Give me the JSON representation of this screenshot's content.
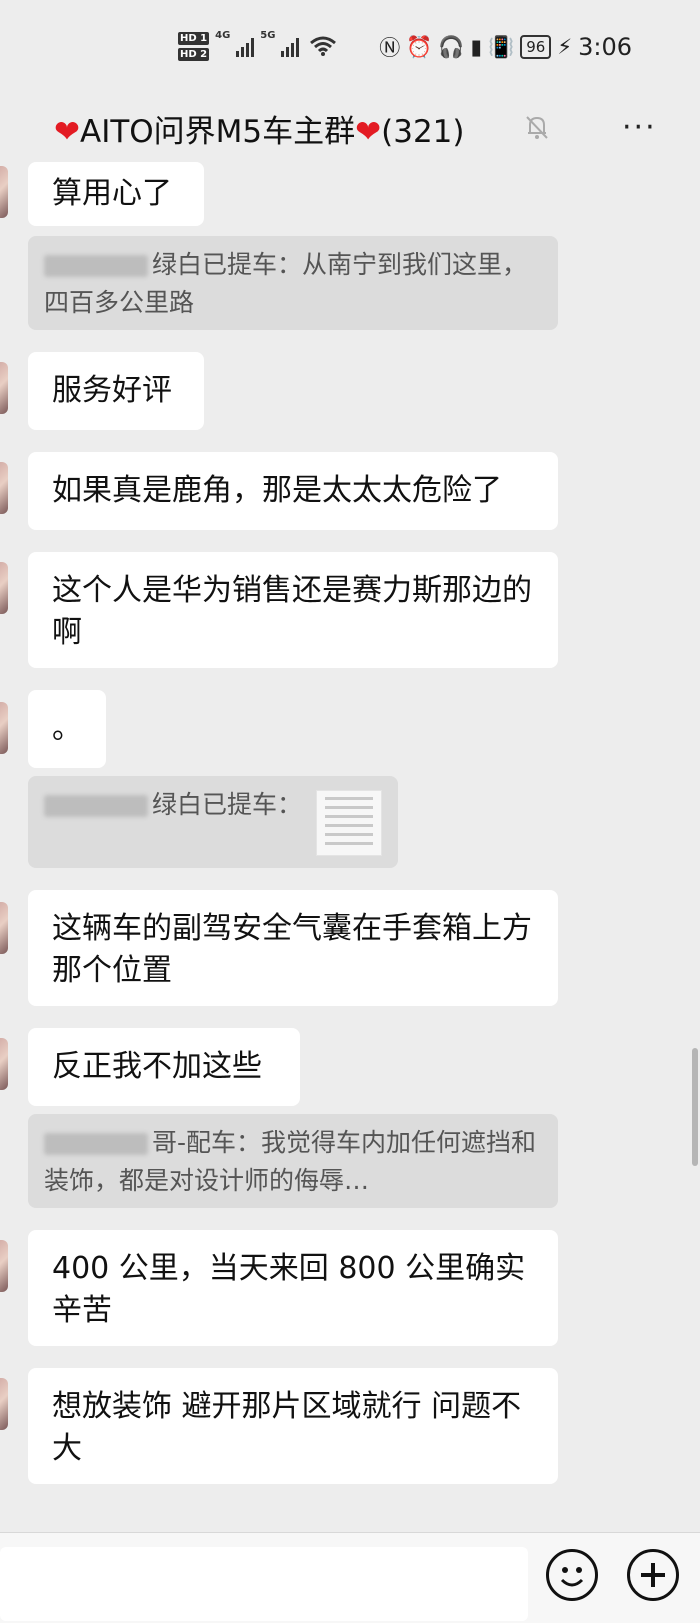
{
  "status_bar": {
    "hd1": "HD 1",
    "hd2": "HD 2",
    "net1": "4G",
    "net2": "5G",
    "battery": "96",
    "time": "3:06",
    "icons": [
      "nfc-icon",
      "alarm-icon",
      "headphones-icon",
      "battery-saver-icon",
      "vibrate-icon",
      "charging-icon"
    ]
  },
  "header": {
    "title": "AITO问界M5车主群",
    "count": "(321)",
    "more": "···",
    "heart_color": "#e31b23"
  },
  "messages": [
    {
      "text": "算用心了"
    },
    {
      "quote": "绿白已提车：从南宁到我们这里，四百多公里路"
    },
    {
      "text": "服务好评"
    },
    {
      "text": "如果真是鹿角，那是太太太危险了"
    },
    {
      "text": "这个人是华为销售还是赛力斯那边的啊"
    },
    {
      "text": "。"
    },
    {
      "quote": "绿白已提车："
    },
    {
      "text": "这辆车的副驾安全气囊在手套箱上方那个位置"
    },
    {
      "text": "反正我不加这些"
    },
    {
      "quote": "哥-配车：我觉得车内加任何遮挡和装饰，都是对设计师的侮辱…"
    },
    {
      "text": "400 公里，当天来回 800 公里确实辛苦"
    },
    {
      "text": "想放装饰 避开那片区域就行 问题不大"
    }
  ],
  "bottom_bar": {
    "input_value": "",
    "emoji_icon": "emoji-icon",
    "plus_icon": "plus-icon"
  },
  "colors": {
    "background": "#ededed",
    "bubble": "#ffffff",
    "quote": "#dcdcdc"
  }
}
